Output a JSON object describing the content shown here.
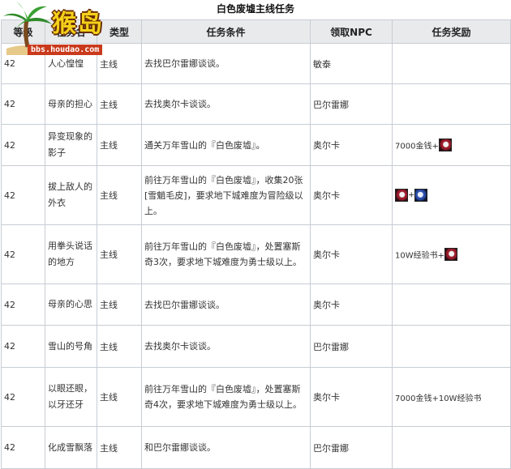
{
  "page": {
    "title": "白色废墟主线任务"
  },
  "watermark": {
    "brand": "猴岛",
    "url": "bbs.houdao.com"
  },
  "table": {
    "headers": {
      "level": "等级",
      "name": "任务名",
      "type": "类型",
      "condition": "任务条件",
      "npc": "领取NPC",
      "reward": "任务奖励"
    },
    "rows": [
      {
        "level": "42",
        "name": "人心惶惶",
        "type": "主线",
        "condition": "去找巴尔雷娜谈谈。",
        "npc": "敏泰",
        "reward_text": "",
        "reward_icons": []
      },
      {
        "level": "42",
        "name": "母亲的担心",
        "type": "主线",
        "condition": "去找奥尔卡谈谈。",
        "npc": "巴尔雷娜",
        "reward_text": "",
        "reward_icons": []
      },
      {
        "level": "42",
        "name": "异变现象的影子",
        "type": "主线",
        "condition": "通关万年雪山的『白色废墟』。",
        "npc": "奥尔卡",
        "reward_text": "7000金钱+",
        "reward_icons": [
          "item-icon"
        ]
      },
      {
        "level": "42",
        "name": "拔上敌人的外衣",
        "type": "主线",
        "condition": "前往万年雪山的『白色废墟』，收集20张[雪魈毛皮]，要求地下城难度为冒险级以上。",
        "npc": "奥尔卡",
        "reward_text": "",
        "reward_icons": [
          "item-icon",
          "item-icon"
        ]
      },
      {
        "level": "42",
        "name": "用拳头说话的地方",
        "type": "主线",
        "condition": "前往万年雪山的『白色废墟』，处置塞斯奇3次，要求地下城难度为勇士级以上。",
        "npc": "奥尔卡",
        "reward_text": "10W经验书+",
        "reward_icons": [
          "item-icon"
        ]
      },
      {
        "level": "42",
        "name": "母亲的心思",
        "type": "主线",
        "condition": "去找巴尔雷娜谈谈。",
        "npc": "奥尔卡",
        "reward_text": "",
        "reward_icons": []
      },
      {
        "level": "42",
        "name": "雪山的号角",
        "type": "主线",
        "condition": "去找奥尔卡谈谈。",
        "npc": "巴尔雷娜",
        "reward_text": "",
        "reward_icons": []
      },
      {
        "level": "42",
        "name": "以眼还眼，以牙还牙",
        "type": "主线",
        "condition": "前往万年雪山的『白色废墟』，处置塞斯奇4次，要求地下城难度为勇士级以上。",
        "npc": "奥尔卡",
        "reward_text": "7000金钱+10W经验书",
        "reward_icons": []
      },
      {
        "level": "42",
        "name": "化成雪飘落",
        "type": "主线",
        "condition": "和巴尔雷娜谈谈。",
        "npc": "巴尔雷娜",
        "reward_text": "",
        "reward_icons": []
      }
    ]
  }
}
